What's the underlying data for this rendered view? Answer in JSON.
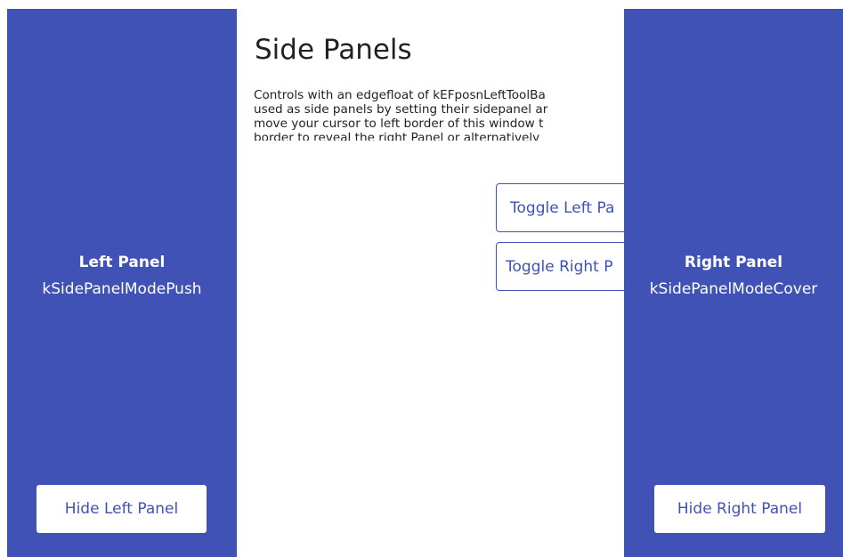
{
  "content": {
    "title": "Side Panels",
    "description_lines": [
      "Controls with an edgefloat of kEFposnLeftToolBa",
      "used as side panels by setting their sidepanel ar",
      "move your cursor to left border of this window t",
      "border to reveal the right Panel or alternatively"
    ],
    "toggle_left_label": "Toggle Left Pa",
    "toggle_right_label": "Toggle Right P"
  },
  "left_panel": {
    "title": "Left Panel",
    "mode": "kSidePanelModePush",
    "hide_button_label": "Hide Left Panel"
  },
  "right_panel": {
    "title": "Right Panel",
    "mode": "kSidePanelModeCover",
    "hide_button_label": "Hide Right Panel"
  },
  "colors": {
    "panel_background": "#4052b5",
    "panel_text": "#ffffff",
    "accent": "#4052b5",
    "page_background": "#ffffff"
  }
}
